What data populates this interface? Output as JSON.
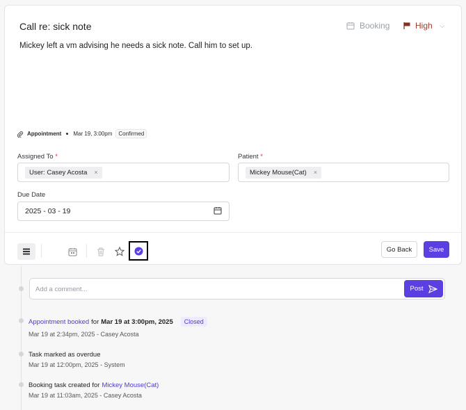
{
  "task": {
    "title": "Call re: sick note",
    "type_label": "Booking",
    "priority_label": "High",
    "description": "Mickey left a vm advising he needs a sick note.  Call him to set up."
  },
  "appointment": {
    "label": "Appointment",
    "datetime": "Mar 19, 3:00pm",
    "status": "Confirmed"
  },
  "form": {
    "assigned_to_label": "Assigned To",
    "assigned_to_value": "User: Casey Acosta",
    "patient_label": "Patient",
    "patient_value": "Mickey Mouse(Cat)",
    "required_mark": "*",
    "due_date_label": "Due Date",
    "due_date_value": "2025 - 03 - 19",
    "chip_remove": "×"
  },
  "toolbar": {
    "go_back_label": "Go Back",
    "save_label": "Save",
    "icons": [
      "list-icon",
      "calendar-icon",
      "trash-icon",
      "star-icon",
      "check-circle-icon"
    ]
  },
  "comment": {
    "placeholder": "Add a comment...",
    "post_label": "Post"
  },
  "timeline": [
    {
      "link_text": "Appointment booked",
      "middle_text": "for",
      "strong_text": "Mar 19 at 3:00pm, 2025",
      "badge": "Closed",
      "meta": "Mar 19 at 2:34pm, 2025 - Casey Acosta"
    },
    {
      "text": "Task marked as overdue",
      "meta": "Mar 19 at 12:00pm, 2025 - System"
    },
    {
      "text": "Booking task created for",
      "link_text": "Mickey Mouse(Cat)",
      "meta": "Mar 19 at 11:03am, 2025 - Casey Acosta"
    }
  ],
  "colors": {
    "accent": "#5b3fe0",
    "priority_flag": "#8b2e22",
    "link": "#4a3bd0"
  }
}
